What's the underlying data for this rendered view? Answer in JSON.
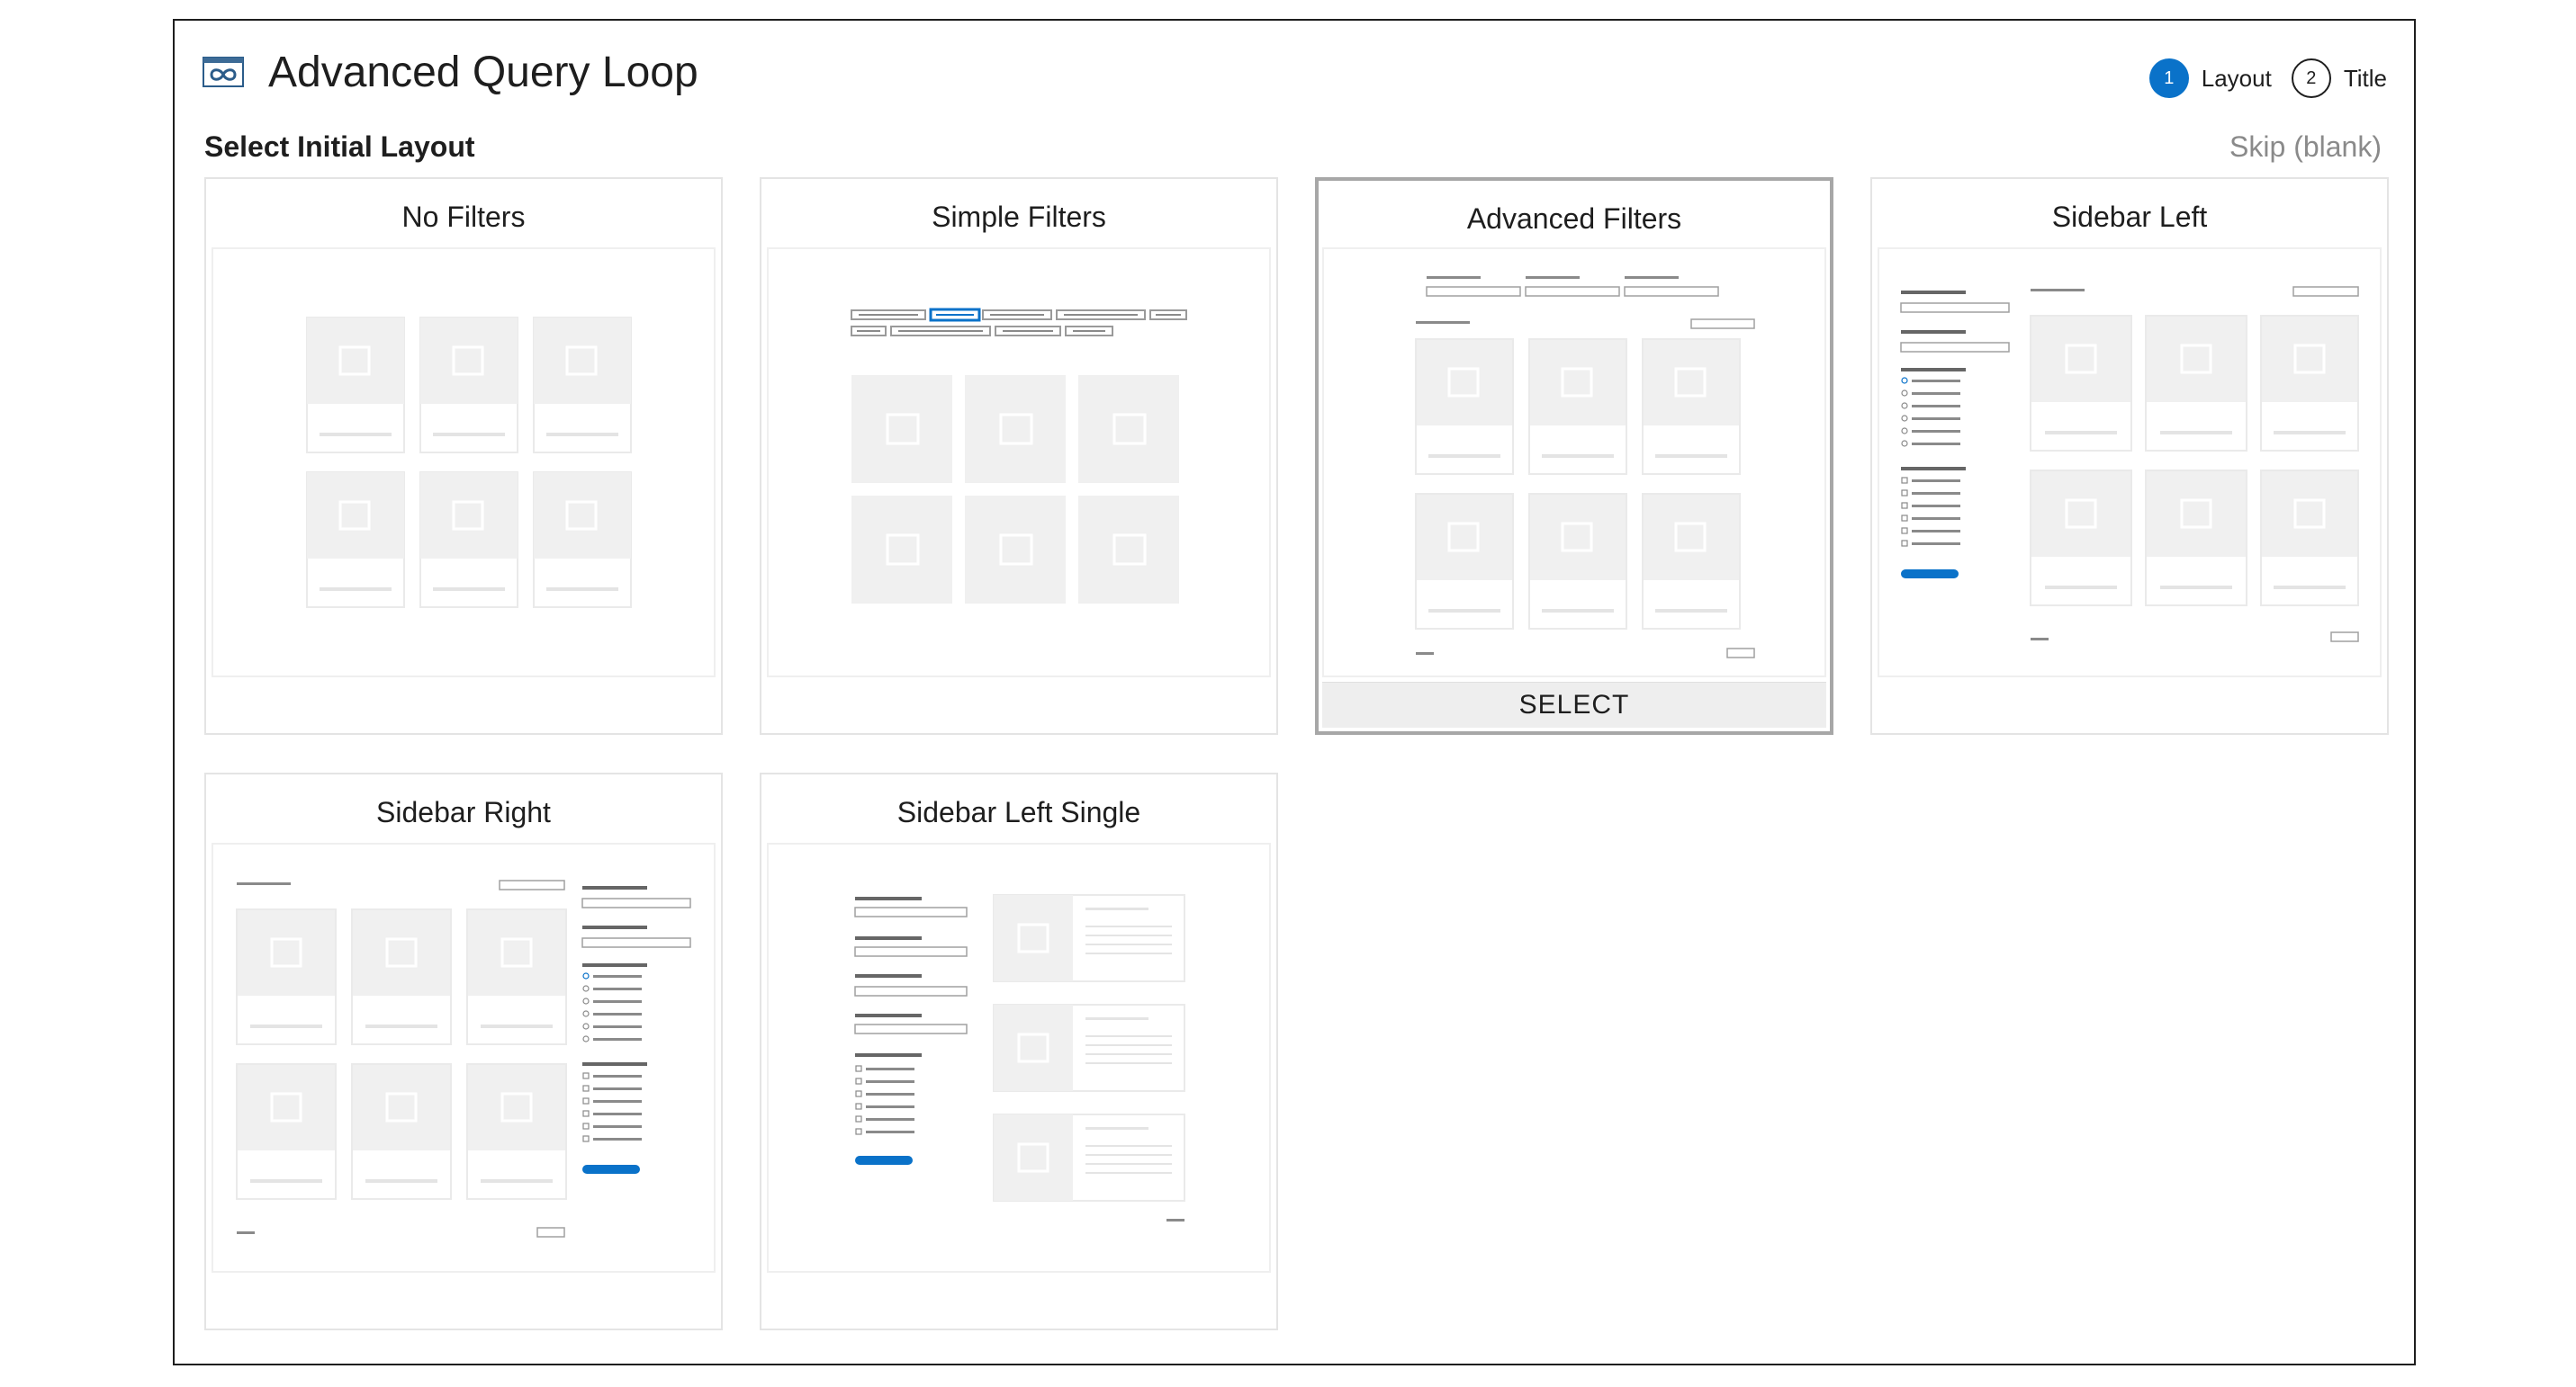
{
  "header": {
    "app_title": "Advanced Query Loop",
    "logo_icon": "infinity-loop-icon",
    "steps": [
      {
        "number": "1",
        "label": "Layout",
        "active": true
      },
      {
        "number": "2",
        "label": "Title",
        "active": false
      }
    ]
  },
  "section": {
    "heading": "Select Initial Layout",
    "skip_label": "Skip (blank)"
  },
  "layouts": [
    {
      "title": "No Filters"
    },
    {
      "title": "Simple Filters"
    },
    {
      "title": "Advanced Filters",
      "select_label": "SELECT"
    },
    {
      "title": "Sidebar Left"
    },
    {
      "title": "Sidebar Right"
    },
    {
      "title": "Sidebar Left Single"
    }
  ],
  "colors": {
    "accent": "#0a72c9",
    "placeholder": "#f0f0f0",
    "line": "#8a8a8a"
  }
}
